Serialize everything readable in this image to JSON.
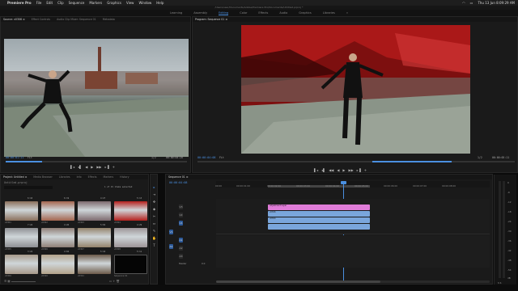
{
  "menubar": {
    "apple": "",
    "app": "Premiere Pro",
    "items": [
      "File",
      "Edit",
      "Clip",
      "Sequence",
      "Markers",
      "Graphics",
      "View",
      "Window",
      "Help"
    ],
    "clock": "Thu 13 Jun  8:09:29 AM",
    "wifi": "wifi-icon",
    "battery": "battery-icon"
  },
  "title": "/Users/user/Documents/Adobe/Premiere Pro/Documents/Untitled.prproj *",
  "workspaces": {
    "items": [
      "Learning",
      "Assembly",
      "Editing",
      "Color",
      "Effects",
      "Audio",
      "Graphics",
      "Libraries"
    ],
    "active": 2,
    "more": "»"
  },
  "source_panel": {
    "tabs": [
      "Source: v0306  ≡",
      "Effect Controls",
      "Audio Clip Mixer: Sequence 01",
      "Metadata"
    ],
    "timecode": "00:00:01:11",
    "fit": "Fit",
    "fraction": "1/2",
    "duration": "00:00:04:26",
    "colors": {
      "sky": "#b9c3c8",
      "roof": "#6f7a73"
    }
  },
  "program_panel": {
    "tabs": [
      "Program: Sequence 01  ≡"
    ],
    "timecode": "00:00:04:08",
    "fit": "Fit",
    "fraction": "1/2",
    "duration": "00:00:05:11",
    "colors": {
      "sky": "#7d0f0f",
      "floor": "#8a9488"
    }
  },
  "controls": {
    "items": [
      "▌◂",
      "◂▌",
      "◀◀",
      "◀",
      "▶",
      "▶▶",
      "▸▐",
      "+"
    ]
  },
  "project_panel": {
    "tabs": [
      "Project: Untitled  ≡",
      "Media Browser",
      "Libraries",
      "Info",
      "Effects",
      "Markers",
      "History"
    ],
    "file": "Untitled.prproj",
    "search_placeholder": "",
    "count": "1 of 15 items selected",
    "thumbs": [
      {
        "label": "v0301",
        "dur": "6:10",
        "color": "#8a6f5b"
      },
      {
        "label": "v0302",
        "dur": "6:19",
        "color": "#a4654e"
      },
      {
        "label": "v0303",
        "dur": "4:27",
        "color": "#7d6a6e"
      },
      {
        "label": "v0304",
        "dur": "5:13",
        "color": "#b5201c"
      },
      {
        "label": "v0305",
        "dur": "7:22",
        "color": "#8e8f93"
      },
      {
        "label": "v0306",
        "dur": "4:26",
        "color": "#8f7f76"
      },
      {
        "label": "v0307",
        "dur": "5:02",
        "color": "#94836b"
      },
      {
        "label": "v0308",
        "dur": "4:29",
        "color": "#9c9497"
      },
      {
        "label": "v0309",
        "dur": "3:24",
        "color": "#a7998a"
      },
      {
        "label": "v0310",
        "dur": "4:04",
        "color": "#b3a28a"
      },
      {
        "label": "v0311",
        "dur": "5:16",
        "color": "#6c5a49"
      },
      {
        "label": "Sequence 01",
        "dur": "5:11",
        "color": "#050505"
      }
    ]
  },
  "timeline": {
    "tabs": [
      "Sequence 01  ≡"
    ],
    "timecode": "00:00:04:08",
    "ruler": [
      "00:00",
      "00:00:01:00",
      "00:00:02:00",
      "00:00:03:00",
      "00:00:04:00",
      "00:00:05:00",
      "00:00:06:00",
      "00:00:07:00",
      "00:00:08:00"
    ],
    "tracks_video": [
      "V3",
      "V2",
      "V1"
    ],
    "tracks_audio": [
      "A1",
      "A2",
      "A3"
    ],
    "master": "Master",
    "master_val": "0.0",
    "clips": [
      {
        "name": "Adjustment Layer",
        "color": "#e07cd8"
      },
      {
        "name": "v0306",
        "color": "#7aa6dc"
      },
      {
        "name": "v0304",
        "color": "#7aa6dc"
      },
      {
        "name": "",
        "color": "#7aa6dc"
      }
    ]
  },
  "tools": [
    "▸",
    "⇥",
    "✥",
    "◆",
    "✂",
    "⇔",
    "✎",
    "✋",
    "T"
  ],
  "meter": {
    "labels": [
      "0",
      "-6",
      "-12",
      "-18",
      "-24",
      "-30",
      "-36",
      "-42",
      "-48",
      "-54",
      "dB"
    ],
    "ss": "S S"
  }
}
